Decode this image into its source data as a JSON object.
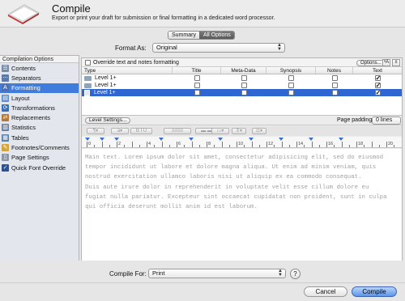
{
  "header": {
    "title": "Compile",
    "subtitle": "Export or print your draft for submission or final formatting in a dedicated word processor."
  },
  "tabs": [
    {
      "label": "Summary",
      "active": false
    },
    {
      "label": "All Options",
      "active": true
    }
  ],
  "format_as": {
    "label": "Format As:",
    "value": "Original"
  },
  "sidebar": {
    "heading": "Compilation Options",
    "items": [
      {
        "label": "Contents",
        "icon": "contents-icon",
        "selected": false
      },
      {
        "label": "Separators",
        "icon": "separators-icon",
        "selected": false
      },
      {
        "label": "Formatting",
        "icon": "formatting-icon",
        "selected": true
      },
      {
        "label": "Layout",
        "icon": "layout-icon",
        "selected": false
      },
      {
        "label": "Transformations",
        "icon": "transformations-icon",
        "selected": false
      },
      {
        "label": "Replacements",
        "icon": "replacements-icon",
        "selected": false
      },
      {
        "label": "Statistics",
        "icon": "statistics-icon",
        "selected": false
      },
      {
        "label": "Tables",
        "icon": "tables-icon",
        "selected": false
      },
      {
        "label": "Footnotes/Comments",
        "icon": "footnotes-icon",
        "selected": false
      },
      {
        "label": "Page Settings",
        "icon": "page-settings-icon",
        "selected": false
      },
      {
        "label": "Quick Font Override",
        "icon": "font-override-icon",
        "selected": false
      }
    ]
  },
  "formatting": {
    "override_label": "Override text and notes formatting",
    "override_checked": false,
    "options_button": "Options...",
    "columns": [
      "Type",
      "Title",
      "Meta-Data",
      "Synopsis",
      "Notes",
      "Text"
    ],
    "rows": [
      {
        "type": "Level  1+",
        "kind": "folder",
        "title": false,
        "meta": false,
        "synopsis": false,
        "notes": false,
        "text": true,
        "selected": false
      },
      {
        "type": "Level  1+",
        "kind": "folder",
        "title": false,
        "meta": false,
        "synopsis": false,
        "notes": false,
        "text": true,
        "selected": false
      },
      {
        "type": "Level  1+",
        "kind": "page",
        "title": false,
        "meta": false,
        "synopsis": false,
        "notes": false,
        "text": true,
        "selected": true
      }
    ],
    "level_settings_button": "Level Settings...",
    "page_padding_label": "Page padding:",
    "page_padding_value": "0 lines"
  },
  "ruler_numbers": [
    "0",
    "2",
    "4",
    "6",
    "8",
    "10",
    "12",
    "14",
    "16",
    "18",
    "20"
  ],
  "preview_lines": [
    "Main text. Lorem ipsum dolor sit amet, consectetur adipisicing elit, sed do eiusmod",
    "tempor incididunt ut labore et dolore magna aliqua. Ut enim ad minim veniam, quis",
    "nostrud exercitation ullamco laboris nisi ut aliquip ex ea commodo consequat.",
    "Duis aute irure dolor in reprehenderit in voluptate velit esse cillum dolore eu",
    "fugiat nulla pariatur. Excepteur sint occaecat cupidatat non proident, sunt in culpa",
    "qui officia deserunt mollit anim id est laborum."
  ],
  "footer": {
    "compile_for_label": "Compile For:",
    "compile_for_value": "Print",
    "help_label": "?",
    "cancel_label": "Cancel",
    "compile_label": "Compile"
  }
}
